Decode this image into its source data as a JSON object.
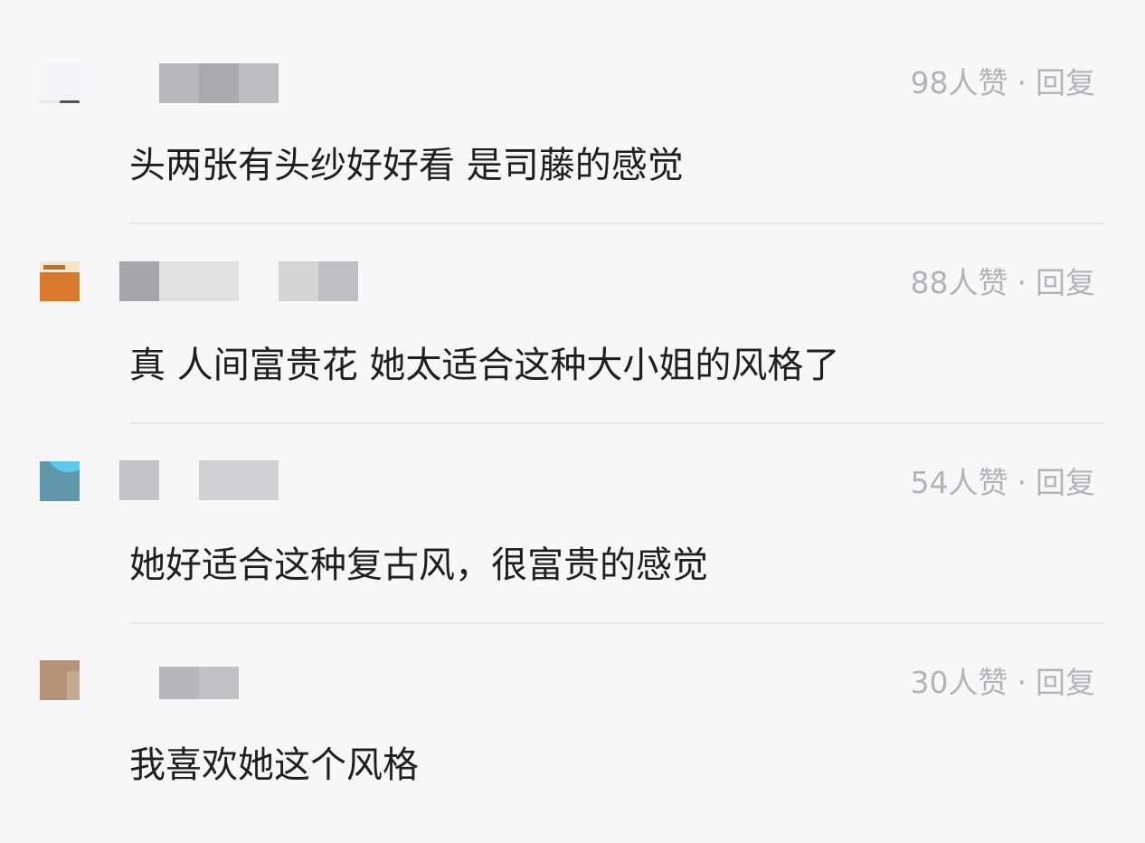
{
  "comments": [
    {
      "likes": "98",
      "likes_unit": "人赞",
      "separator": "·",
      "reply_label": "回复",
      "text": "头两张有头纱好好看 是司藤的感觉"
    },
    {
      "likes": "88",
      "likes_unit": "人赞",
      "separator": "·",
      "reply_label": "回复",
      "text": "真 人间富贵花 她太适合这种大小姐的风格了"
    },
    {
      "likes": "54",
      "likes_unit": "人赞",
      "separator": "·",
      "reply_label": "回复",
      "text": "她好适合这种复古风，很富贵的感觉"
    },
    {
      "likes": "30",
      "likes_unit": "人赞",
      "separator": "·",
      "reply_label": "回复",
      "text": "我喜欢她这个风格"
    }
  ],
  "colors": {
    "background": "#f7f7f9",
    "comment_text": "#1f1f22",
    "meta_text": "#b3b3b8",
    "divider": "#e6e6ea"
  }
}
